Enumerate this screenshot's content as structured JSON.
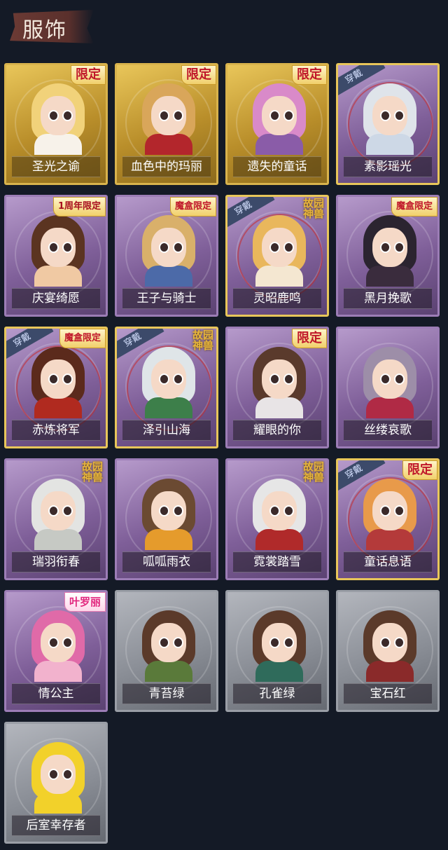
{
  "header": {
    "title": "服饰"
  },
  "outfits": [
    {
      "name": "圣光之谕",
      "tag": "限定",
      "tagType": "limited",
      "frame": "gold",
      "worn": false,
      "hair": "#f1d27a",
      "outfit": "#f7f2ea"
    },
    {
      "name": "血色中的玛丽",
      "tag": "限定",
      "tagType": "limited",
      "frame": "gold",
      "worn": false,
      "hair": "#d9a65a",
      "outfit": "#b3262c"
    },
    {
      "name": "遗失的童话",
      "tag": "限定",
      "tagType": "limited",
      "frame": "gold",
      "worn": false,
      "hair": "#d98ac9",
      "outfit": "#8a5ca8"
    },
    {
      "name": "素影瑶光",
      "tag": "",
      "tagType": "",
      "frame": "purple",
      "worn": true,
      "worn_label": "穿戴",
      "hair": "#dfe4ea",
      "outfit": "#cdd8e6"
    },
    {
      "name": "庆宴绮愿",
      "tag": "1周年限定",
      "tagType": "anniv",
      "frame": "purple",
      "worn": false,
      "hair": "#5b3421",
      "outfit": "#f0c9a3"
    },
    {
      "name": "王子与骑士",
      "tag": "魔盒限定",
      "tagType": "box",
      "frame": "purple",
      "worn": false,
      "hair": "#d9b06a",
      "outfit": "#4c6aa8"
    },
    {
      "name": "灵昭鹿鸣",
      "tag": "故园神兽",
      "tagType": "lore",
      "frame": "purple",
      "worn": true,
      "worn_label": "穿戴",
      "hair": "#e9b75c",
      "outfit": "#f4e7d1"
    },
    {
      "name": "黑月挽歌",
      "tag": "魔盒限定",
      "tagType": "box",
      "frame": "purple",
      "worn": false,
      "hair": "#2b2430",
      "outfit": "#3a2c3d"
    },
    {
      "name": "赤炼将军",
      "tag": "魔盒限定",
      "tagType": "box",
      "frame": "purple",
      "worn": true,
      "worn_label": "穿戴",
      "hair": "#5b2a1c",
      "outfit": "#b02a1f"
    },
    {
      "name": "泽引山海",
      "tag": "故园神兽",
      "tagType": "lore",
      "frame": "purple",
      "worn": true,
      "worn_label": "穿戴",
      "hair": "#dfe5e8",
      "outfit": "#3d7f4a"
    },
    {
      "name": "耀眼的你",
      "tag": "限定",
      "tagType": "limited",
      "frame": "purple",
      "worn": false,
      "hair": "#5a3a2c",
      "outfit": "#e8e4e6"
    },
    {
      "name": "丝缕哀歌",
      "tag": "",
      "tagType": "",
      "frame": "purple",
      "worn": false,
      "hair": "#9d8ea8",
      "outfit": "#b02a45"
    },
    {
      "name": "瑞羽衔春",
      "tag": "故园神兽",
      "tagType": "lore",
      "frame": "purple",
      "worn": false,
      "hair": "#e3e4e2",
      "outfit": "#c6c9c4"
    },
    {
      "name": "呱呱雨衣",
      "tag": "",
      "tagType": "",
      "frame": "purple",
      "worn": false,
      "hair": "#6b4a32",
      "outfit": "#e59b2c"
    },
    {
      "name": "霓裳踏雪",
      "tag": "故园神兽",
      "tagType": "lore",
      "frame": "purple",
      "worn": false,
      "hair": "#e6e6e6",
      "outfit": "#b02a2a"
    },
    {
      "name": "童话息语",
      "tag": "限定",
      "tagType": "limited",
      "frame": "purple",
      "worn": true,
      "worn_label": "穿戴",
      "hair": "#e89a4a",
      "outfit": "#b43a3a"
    },
    {
      "name": "情公主",
      "tag": "叶罗丽",
      "tagType": "pink",
      "frame": "purple",
      "worn": false,
      "hair": "#e06aa8",
      "outfit": "#f2b2cd"
    },
    {
      "name": "青苔绿",
      "tag": "",
      "tagType": "",
      "frame": "grey",
      "worn": false,
      "hair": "#5b3a2a",
      "outfit": "#5a7a3a"
    },
    {
      "name": "孔雀绿",
      "tag": "",
      "tagType": "",
      "frame": "grey",
      "worn": false,
      "hair": "#5b3a2a",
      "outfit": "#2f6b5b"
    },
    {
      "name": "宝石红",
      "tag": "",
      "tagType": "",
      "frame": "grey",
      "worn": false,
      "hair": "#5b3a2a",
      "outfit": "#8a2a2a"
    },
    {
      "name": "后室幸存者",
      "tag": "",
      "tagType": "",
      "frame": "grey",
      "worn": false,
      "hair": "#f2d12a",
      "outfit": "#f2d12a"
    }
  ]
}
